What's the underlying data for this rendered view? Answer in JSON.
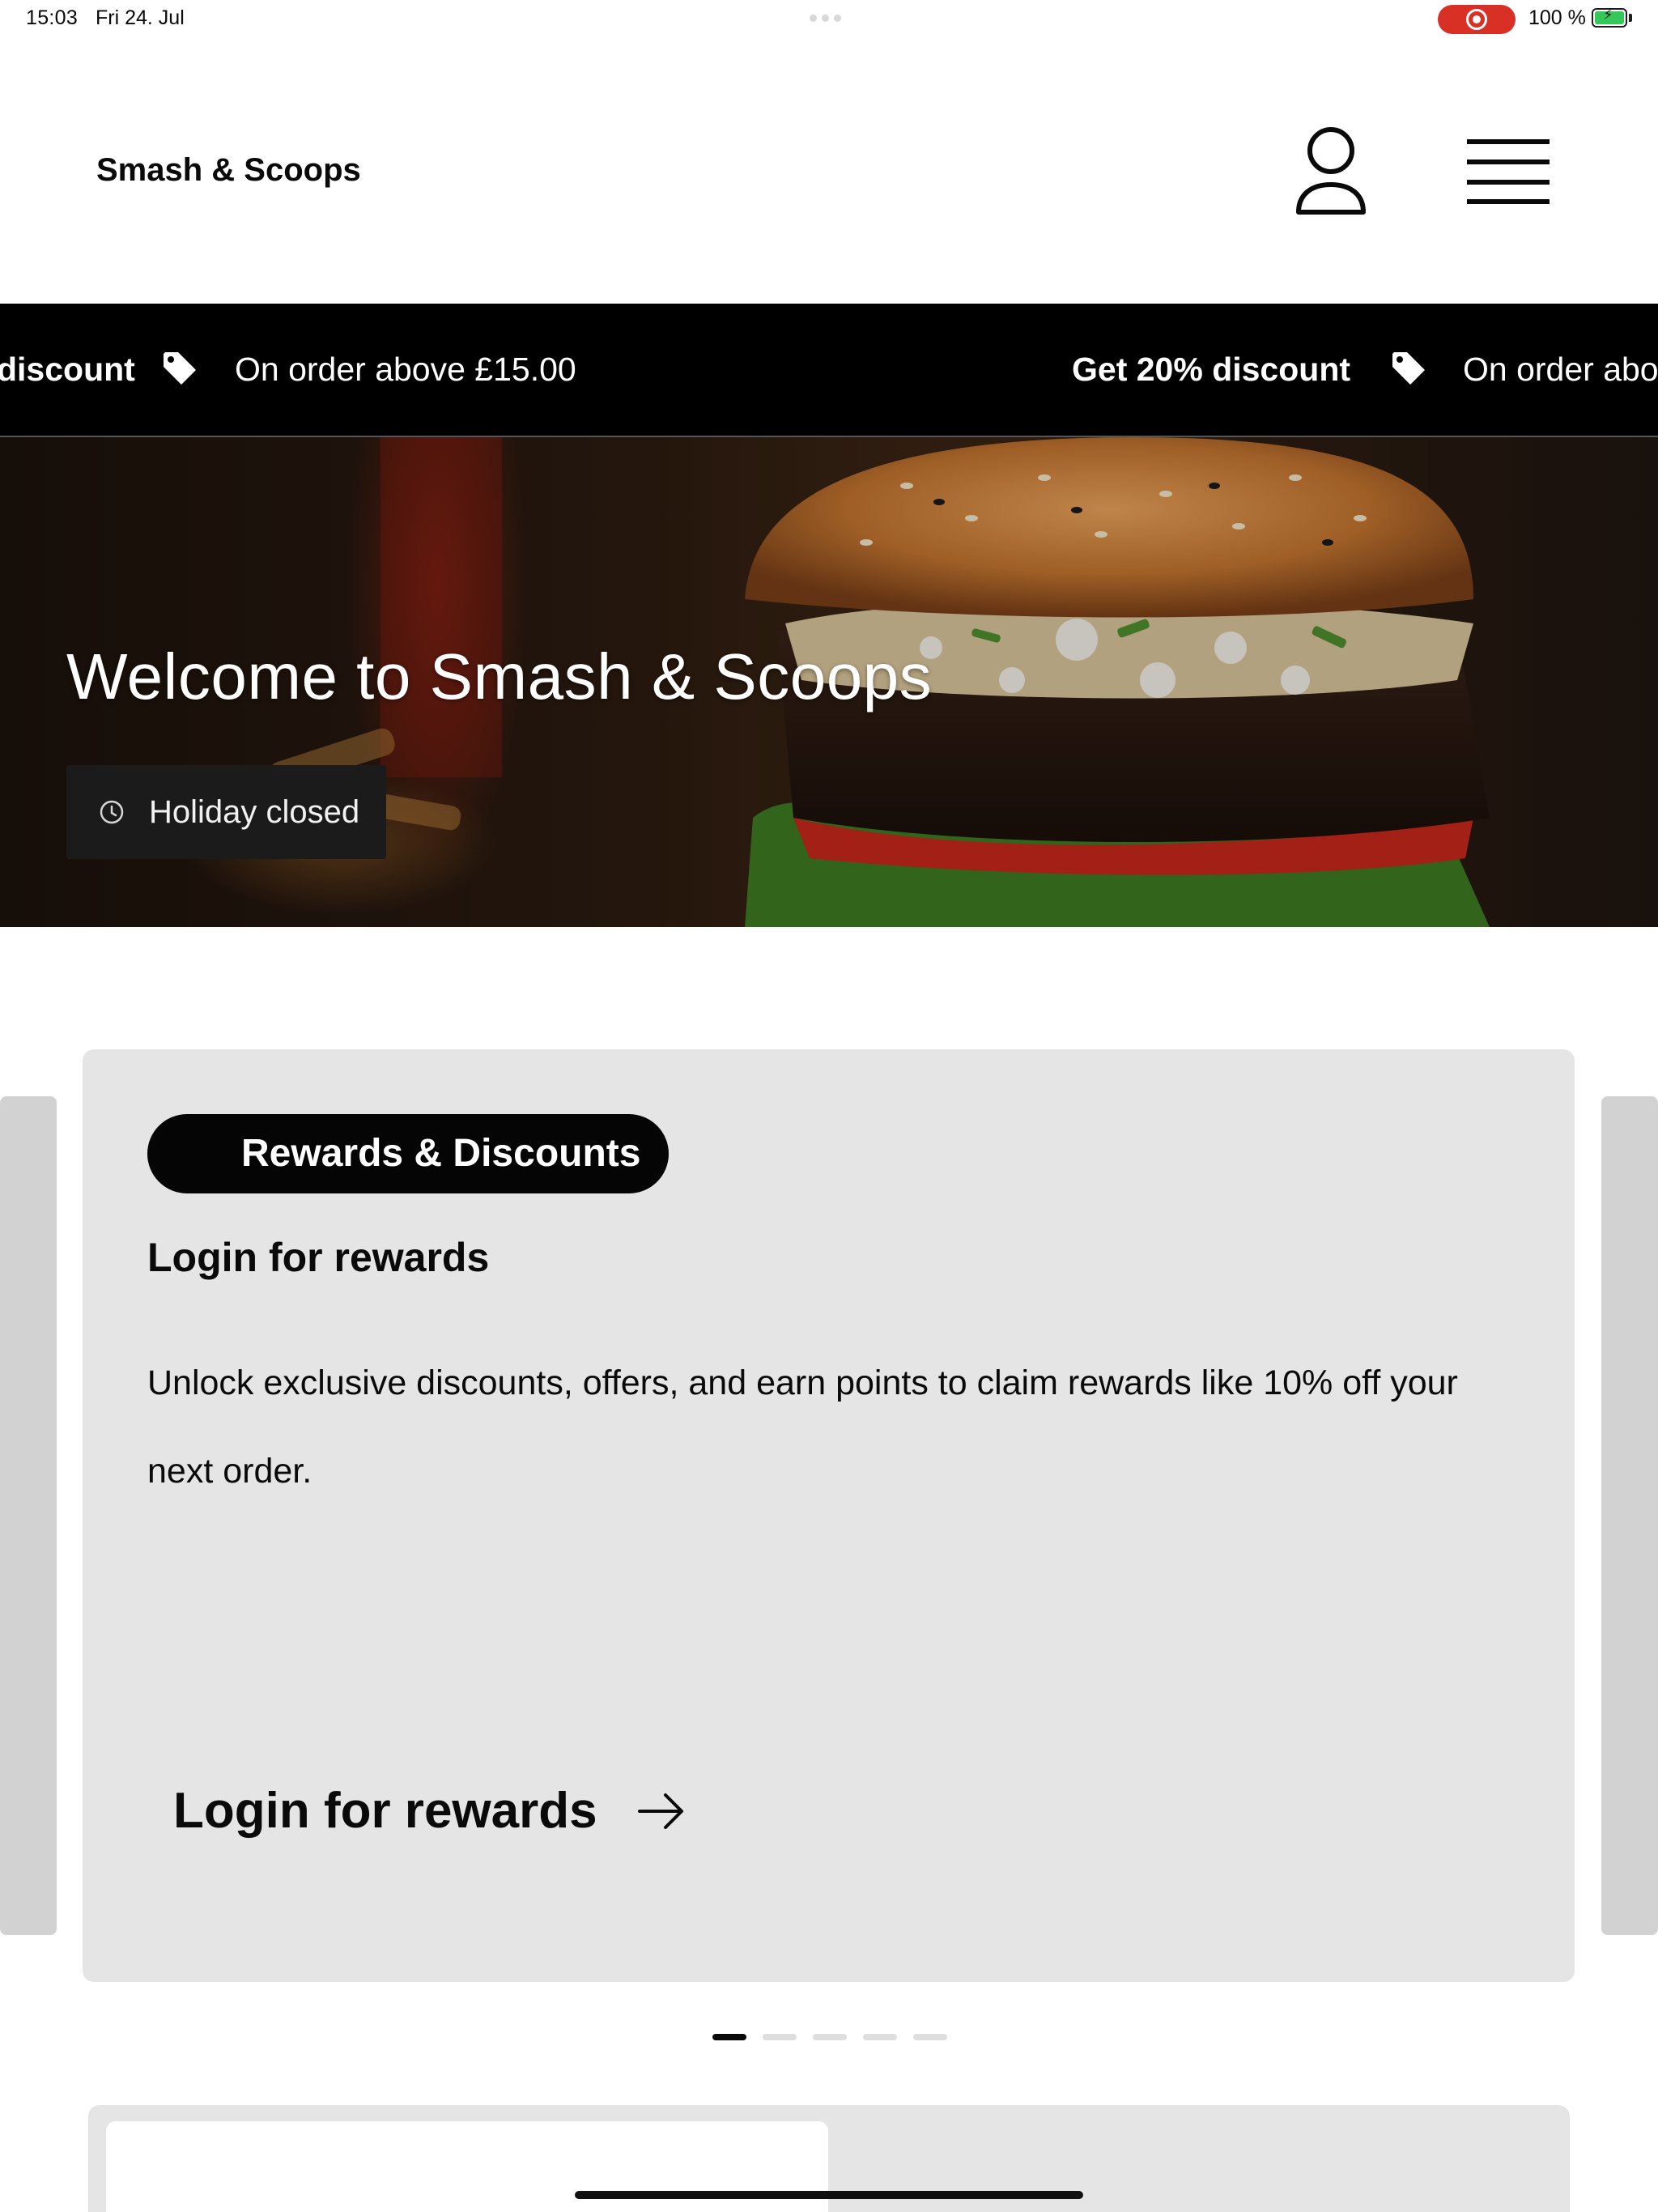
{
  "status_bar": {
    "time": "15:03",
    "date": "Fri 24. Jul",
    "battery_text": "100 %",
    "recording_color": "#d93025",
    "battery_color": "#34c759"
  },
  "header": {
    "brand": "Smash & Scoops",
    "account_icon": "user-icon",
    "menu_icon": "hamburger-menu-icon"
  },
  "ticker": {
    "items": [
      {
        "highlight": "discount",
        "detail": "On order above £15.00"
      },
      {
        "highlight": "Get 20% discount",
        "detail": "On order abov"
      }
    ],
    "icon": "tag-icon",
    "background": "#000000"
  },
  "hero": {
    "title": "Welcome to Smash & Scoops",
    "status_label": "Holiday closed",
    "status_icon": "clock-icon"
  },
  "rewards_card": {
    "badge": "Rewards & Discounts",
    "title": "Login for rewards",
    "body": "Unlock exclusive discounts, offers, and earn points to claim rewards like 10% off your next order.",
    "cta_label": "Login for rewards",
    "cta_icon": "arrow-right-icon"
  },
  "carousel": {
    "page_count": 5,
    "active_index": 0
  }
}
